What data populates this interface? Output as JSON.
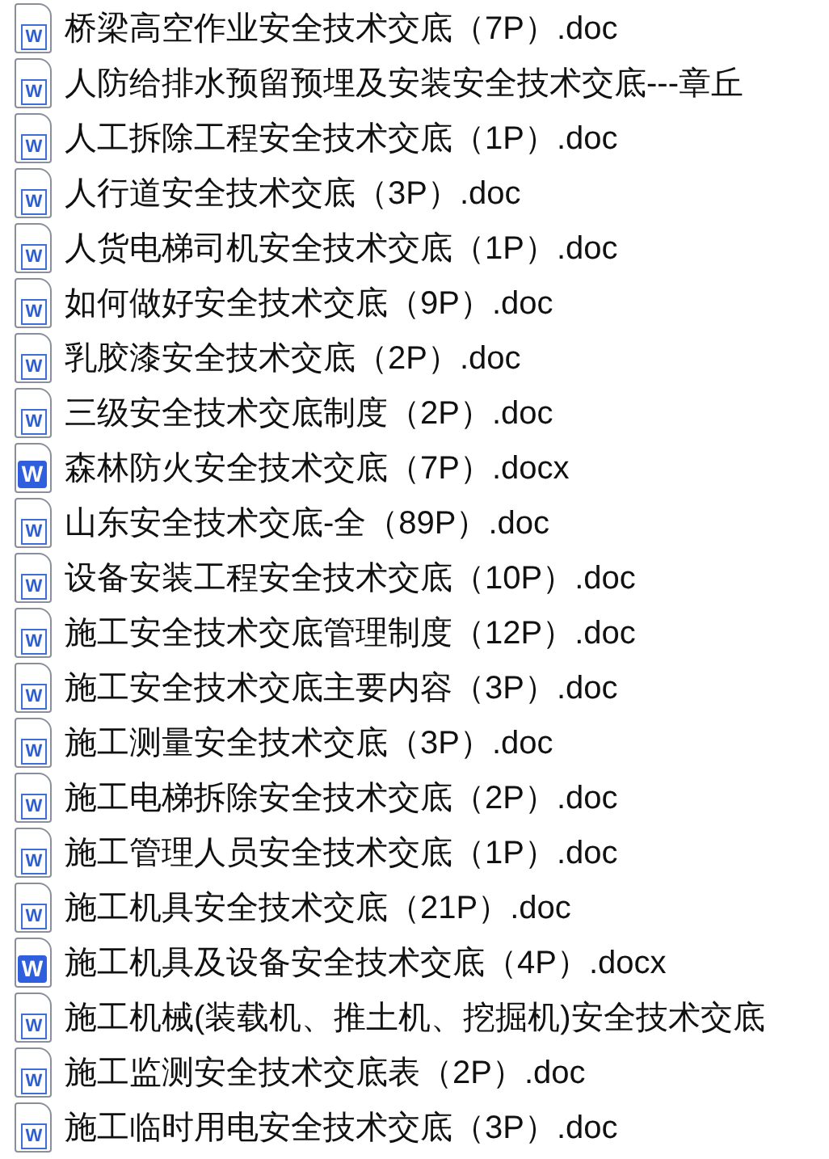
{
  "files": [
    {
      "kind": "doc",
      "icon_letter": "W",
      "name": "桥梁高空作业安全技术交底（7P）.doc"
    },
    {
      "kind": "doc",
      "icon_letter": "W",
      "name": "人防给排水预留预埋及安装安全技术交底---章丘"
    },
    {
      "kind": "doc",
      "icon_letter": "W",
      "name": "人工拆除工程安全技术交底（1P）.doc"
    },
    {
      "kind": "doc",
      "icon_letter": "W",
      "name": "人行道安全技术交底（3P）.doc"
    },
    {
      "kind": "doc",
      "icon_letter": "W",
      "name": "人货电梯司机安全技术交底（1P）.doc"
    },
    {
      "kind": "doc",
      "icon_letter": "W",
      "name": "如何做好安全技术交底（9P）.doc"
    },
    {
      "kind": "doc",
      "icon_letter": "W",
      "name": "乳胶漆安全技术交底（2P）.doc"
    },
    {
      "kind": "doc",
      "icon_letter": "W",
      "name": "三级安全技术交底制度（2P）.doc"
    },
    {
      "kind": "docx",
      "icon_letter": "W",
      "name": "森林防火安全技术交底（7P）.docx"
    },
    {
      "kind": "doc",
      "icon_letter": "W",
      "name": "山东安全技术交底-全（89P）.doc"
    },
    {
      "kind": "doc",
      "icon_letter": "W",
      "name": "设备安装工程安全技术交底（10P）.doc"
    },
    {
      "kind": "doc",
      "icon_letter": "W",
      "name": "施工安全技术交底管理制度（12P）.doc"
    },
    {
      "kind": "doc",
      "icon_letter": "W",
      "name": "施工安全技术交底主要内容（3P）.doc"
    },
    {
      "kind": "doc",
      "icon_letter": "W",
      "name": "施工测量安全技术交底（3P）.doc"
    },
    {
      "kind": "doc",
      "icon_letter": "W",
      "name": "施工电梯拆除安全技术交底（2P）.doc"
    },
    {
      "kind": "doc",
      "icon_letter": "W",
      "name": "施工管理人员安全技术交底（1P）.doc"
    },
    {
      "kind": "doc",
      "icon_letter": "W",
      "name": "施工机具安全技术交底（21P）.doc"
    },
    {
      "kind": "docx",
      "icon_letter": "W",
      "name": "施工机具及设备安全技术交底（4P）.docx"
    },
    {
      "kind": "doc",
      "icon_letter": "W",
      "name": "施工机械(装载机、推土机、挖掘机)安全技术交底"
    },
    {
      "kind": "doc",
      "icon_letter": "W",
      "name": "施工监测安全技术交底表（2P）.doc"
    },
    {
      "kind": "doc",
      "icon_letter": "W",
      "name": "施工临时用电安全技术交底（3P）.doc"
    }
  ]
}
